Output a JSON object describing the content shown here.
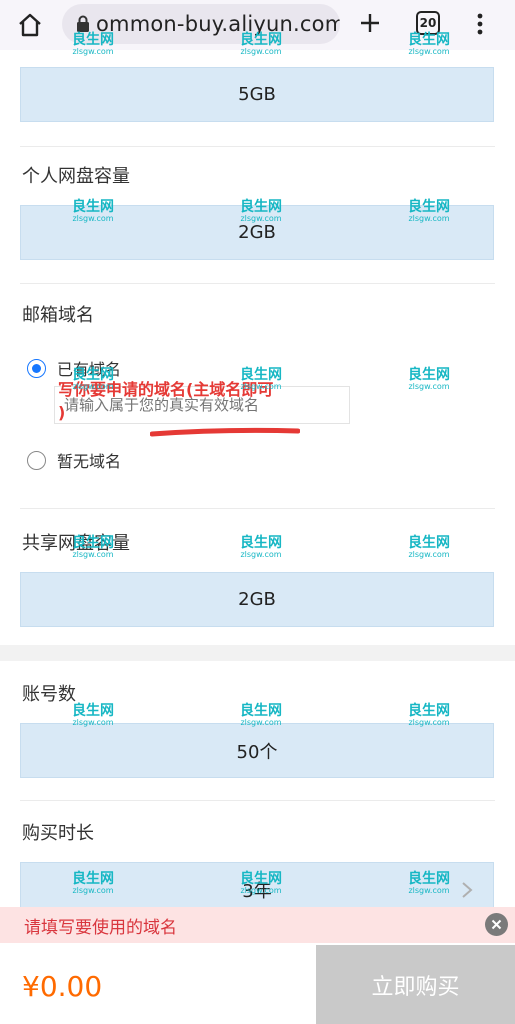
{
  "browser": {
    "url": "ommon-buy.aliyun.com",
    "tab_count": "20"
  },
  "sections": {
    "storage_value": "5GB",
    "personal_disk": {
      "label": "个人网盘容量",
      "value": "2GB"
    },
    "mail_domain": {
      "label": "邮箱域名",
      "option_existing": "已有域名",
      "input_placeholder": "请输入属于您的真实有效域名",
      "option_none": "暂无域名"
    },
    "shared_disk": {
      "label": "共享网盘容量",
      "value": "2GB"
    },
    "accounts": {
      "label": "账号数",
      "value": "50个"
    },
    "duration": {
      "label": "购买时长",
      "value": "3年"
    }
  },
  "annotation": {
    "line1": "写你要申请的域名(主域名即可",
    "line2": ")",
    "color": "#e53935"
  },
  "watermark": {
    "main": "良生网",
    "sub": "zlsgw.com",
    "color": "#17b7c4"
  },
  "toast": {
    "message": "请填写要使用的域名"
  },
  "footer": {
    "price": "¥0.00",
    "buy_label": "立即购买"
  },
  "colors": {
    "field_bg": "#d9e9f6",
    "price": "#ff6a00",
    "accent": "#1677ff",
    "error": "#d9363e",
    "buy_disabled": "#c9c9c9"
  }
}
